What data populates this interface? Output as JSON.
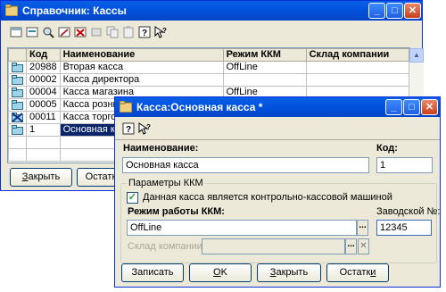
{
  "main_window": {
    "title": "Справочник: Кассы",
    "columns": [
      "",
      "Код",
      "Наименование",
      "Режим ККМ",
      "Склад компании"
    ],
    "rows": [
      {
        "code": "20988",
        "name": "Вторая касса",
        "mode": "OffLine",
        "warehouse": "",
        "icon": "folder-icon"
      },
      {
        "code": "00002",
        "name": "Касса директора",
        "mode": "",
        "warehouse": "",
        "icon": "folder-icon"
      },
      {
        "code": "00004",
        "name": "Касса магазина",
        "mode": "OffLine",
        "warehouse": "",
        "icon": "folder-icon"
      },
      {
        "code": "00005",
        "name": "Касса розничн",
        "mode": "",
        "warehouse": "",
        "icon": "folder-icon"
      },
      {
        "code": "00011",
        "name": "Касса торгово",
        "mode": "",
        "warehouse": "",
        "icon": "deleted-folder-icon"
      },
      {
        "code": "1",
        "name": "Основная касс",
        "mode": "",
        "warehouse": "",
        "icon": "folder-icon"
      }
    ],
    "buttons": {
      "close": "Закрыть",
      "remainders": "Остатки"
    },
    "close_mnemonic": "З",
    "close_rest": "акрыть",
    "remainders_prefix": "Остатк",
    "remainders_mnemonic": "и"
  },
  "dialog": {
    "title": "Касса:Основная касса *",
    "name_label": "Наименование:",
    "name_value": "Основная касса",
    "code_label": "Код:",
    "code_value": "1",
    "group_label": "Параметры ККМ",
    "checkbox_label": "Данная касса является контрольно-кассовой машиной",
    "checkbox_checked": true,
    "mode_label": "Режим работы ККМ:",
    "mode_value": "OffLine",
    "serial_label": "Заводской №:",
    "serial_value": "12345",
    "warehouse_label": "Склад компании:",
    "warehouse_value": "",
    "buttons": {
      "save": "Записать",
      "ok_mnemonic": "О",
      "ok_rest": "K",
      "close_mnemonic": "З",
      "close_rest": "акрыть",
      "remainders_prefix": "Остатк",
      "remainders_mnemonic": "и"
    }
  },
  "colors": {
    "title_bar": "#0054e3",
    "selection": "#0a246a",
    "window_bg": "#ece9d8"
  }
}
